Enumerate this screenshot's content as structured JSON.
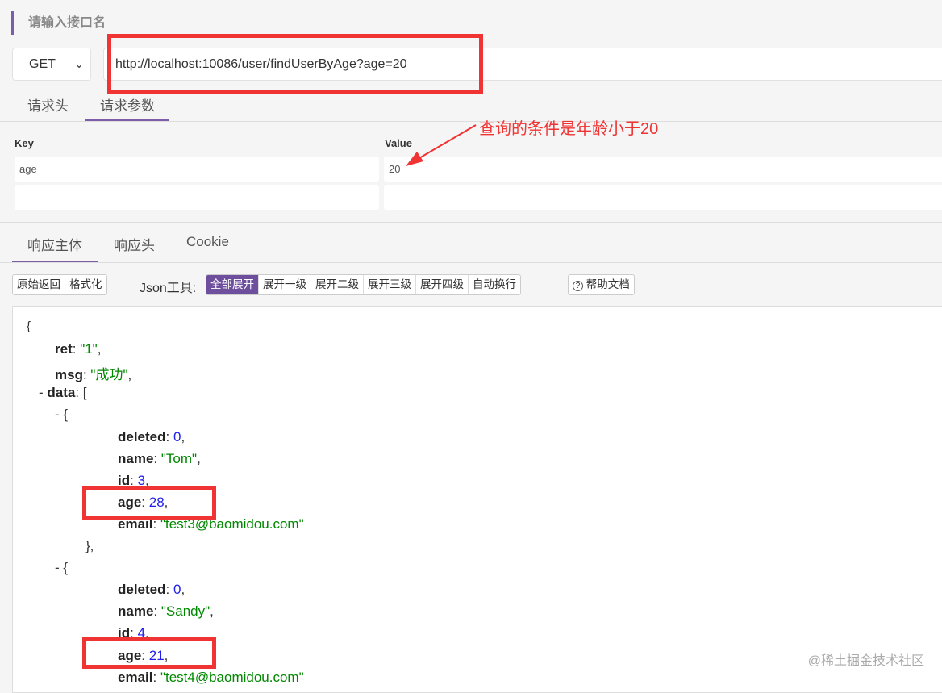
{
  "title": "请输入接口名",
  "request": {
    "method": "GET",
    "url": "http://localhost:10086/user/findUserByAge?age=20"
  },
  "request_tabs": [
    "请求头",
    "请求参数"
  ],
  "params": {
    "key_header": "Key",
    "value_header": "Value",
    "rows": [
      {
        "key": "age",
        "value": "20"
      },
      {
        "key": "",
        "value": ""
      }
    ]
  },
  "annotation": "查询的条件是年龄小于20",
  "response_tabs": [
    "响应主体",
    "响应头",
    "Cookie"
  ],
  "toolbar": {
    "view_buttons": [
      "原始返回",
      "格式化"
    ],
    "json_tools_label": "Json工具:",
    "json_buttons": [
      "全部展开",
      "展开一级",
      "展开二级",
      "展开三级",
      "展开四级",
      "自动换行"
    ],
    "help": "帮助文档"
  },
  "json_lines": [
    {
      "indent": 0,
      "parts": [
        [
          "p",
          "{"
        ]
      ]
    },
    {
      "indent": 1,
      "parts": [
        [
          "k",
          "ret"
        ],
        [
          "p",
          ": "
        ],
        [
          "s",
          "\"1\""
        ],
        [
          "p",
          ","
        ]
      ]
    },
    {
      "indent": 1,
      "parts": [
        [
          "k",
          "msg"
        ],
        [
          "p",
          ": "
        ],
        [
          "s",
          "\"成功\""
        ],
        [
          "p",
          ","
        ]
      ]
    },
    {
      "indent": 1,
      "toggle": true,
      "parts": [
        [
          "k",
          "data"
        ],
        [
          "p",
          ": ["
        ]
      ]
    },
    {
      "indent": 2,
      "toggle": true,
      "parts": [
        [
          "p",
          "{"
        ]
      ]
    },
    {
      "indent": 3,
      "parts": [
        [
          "k",
          "deleted"
        ],
        [
          "p",
          ": "
        ],
        [
          "n",
          "0"
        ],
        [
          "p",
          ","
        ]
      ]
    },
    {
      "indent": 3,
      "parts": [
        [
          "k",
          "name"
        ],
        [
          "p",
          ": "
        ],
        [
          "s",
          "\"Tom\""
        ],
        [
          "p",
          ","
        ]
      ]
    },
    {
      "indent": 3,
      "parts": [
        [
          "k",
          "id"
        ],
        [
          "p",
          ": "
        ],
        [
          "n",
          "3"
        ],
        [
          "p",
          ","
        ]
      ]
    },
    {
      "indent": 3,
      "parts": [
        [
          "k",
          "age"
        ],
        [
          "p",
          ": "
        ],
        [
          "n",
          "28"
        ],
        [
          "p",
          ","
        ]
      ]
    },
    {
      "indent": 3,
      "parts": [
        [
          "k",
          "email"
        ],
        [
          "p",
          ": "
        ],
        [
          "s",
          "\"test3@baomidou.com\""
        ]
      ]
    },
    {
      "indent": 2.5,
      "parts": [
        [
          "p",
          "},"
        ]
      ]
    },
    {
      "indent": 2,
      "toggle": true,
      "parts": [
        [
          "p",
          "{"
        ]
      ]
    },
    {
      "indent": 3,
      "parts": [
        [
          "k",
          "deleted"
        ],
        [
          "p",
          ": "
        ],
        [
          "n",
          "0"
        ],
        [
          "p",
          ","
        ]
      ]
    },
    {
      "indent": 3,
      "parts": [
        [
          "k",
          "name"
        ],
        [
          "p",
          ": "
        ],
        [
          "s",
          "\"Sandy\""
        ],
        [
          "p",
          ","
        ]
      ]
    },
    {
      "indent": 3,
      "parts": [
        [
          "k",
          "id"
        ],
        [
          "p",
          ": "
        ],
        [
          "n",
          "4"
        ],
        [
          "p",
          ","
        ]
      ]
    },
    {
      "indent": 3,
      "parts": [
        [
          "k",
          "age"
        ],
        [
          "p",
          ": "
        ],
        [
          "n",
          "21"
        ],
        [
          "p",
          ","
        ]
      ]
    },
    {
      "indent": 3,
      "parts": [
        [
          "k",
          "email"
        ],
        [
          "p",
          ": "
        ],
        [
          "s",
          "\"test4@baomidou.com\""
        ]
      ]
    }
  ],
  "watermark": "@稀土掘金技术社区",
  "colors": {
    "accent": "#6e4f9e",
    "highlight": "#f03333",
    "string": "#008800",
    "number": "#2020ee"
  }
}
